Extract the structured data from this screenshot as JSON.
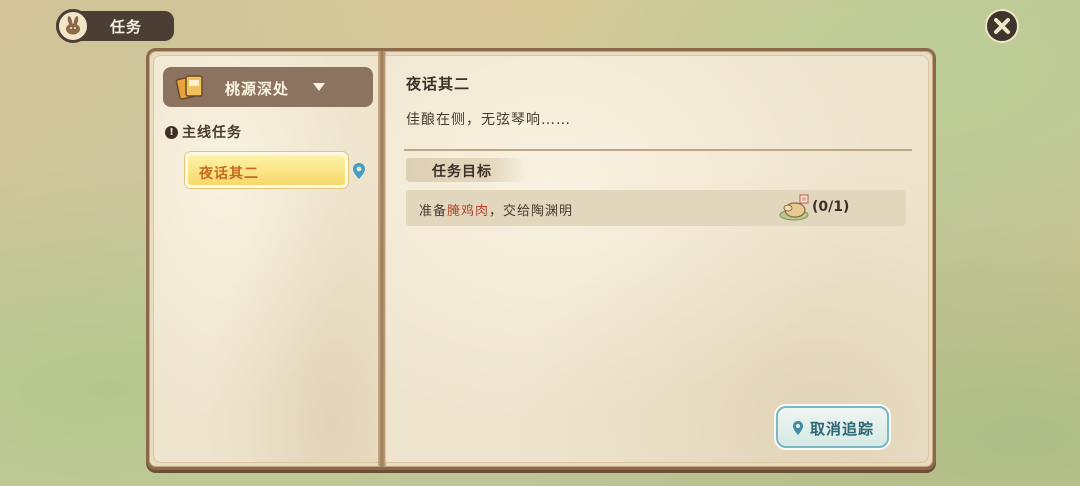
{
  "header": {
    "title": "任务",
    "badge_icon": "rabbit-icon",
    "close_icon": "close-icon"
  },
  "sidebar": {
    "region_dropdown": {
      "label": "桃源深处",
      "icon": "map-cards-icon"
    },
    "main_quest_section": {
      "label": "主线任务",
      "icon": "alert-icon"
    },
    "quests": [
      {
        "label": "夜话其二",
        "selected": true,
        "tracked": true,
        "tracked_icon": "location-pin-icon"
      }
    ]
  },
  "detail": {
    "title": "夜话其二",
    "description": "佳酿在侧，无弦琴响……",
    "goal_header": "任务目标",
    "goals": [
      {
        "text_prefix": "准备",
        "text_highlight": "腌鸡肉",
        "text_suffix": "，交给陶渊明",
        "item_icon": "roast-chicken-icon",
        "count": "(0/1)"
      }
    ]
  },
  "untrack_button": {
    "label": "取消追踪",
    "icon": "location-pin-icon"
  },
  "colors": {
    "highlight_text": "#b3452e",
    "selected_quest_text": "#c56b1e",
    "button_text": "#2e6676"
  }
}
